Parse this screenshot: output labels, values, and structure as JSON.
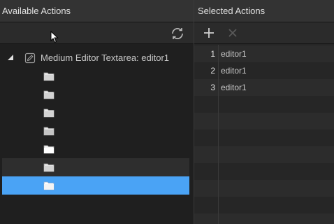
{
  "left_panel": {
    "title": "Available Actions",
    "tree_root_label": "Medium Editor Textarea: editor1"
  },
  "right_panel": {
    "title": "Selected Actions",
    "rows": [
      {
        "num": "1",
        "text": "editor1"
      },
      {
        "num": "2",
        "text": "editor1"
      },
      {
        "num": "3",
        "text": "editor1"
      }
    ]
  },
  "icons": {
    "refresh": "refresh-icon",
    "add": "plus-icon",
    "remove": "close-icon",
    "folder": "folder-icon",
    "edit": "pencil-icon",
    "expander": "triangle-expander-icon"
  },
  "colors": {
    "selection": "#4aa3f5",
    "header_bg": "#333333",
    "panel_bg": "#1f1f1f"
  }
}
